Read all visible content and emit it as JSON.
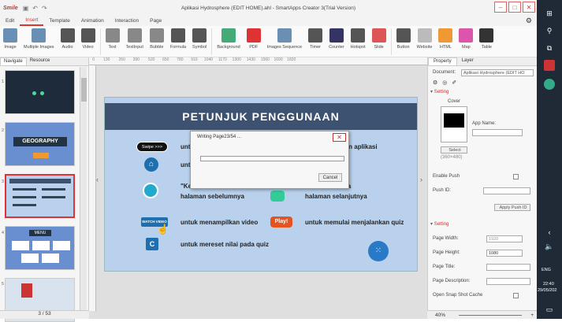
{
  "window": {
    "logo": "Smile",
    "title": "Aplikasi Hydrosphere (EDIT HOME).ahl - SmartApps Creator 3(Trial Version)"
  },
  "menu": [
    "Edit",
    "Insert",
    "Template",
    "Animation",
    "Interaction",
    "Page"
  ],
  "ribbon": [
    {
      "label": "Image",
      "color": "#6a8fb5"
    },
    {
      "label": "Multiple Images",
      "color": "#6a8fb5"
    },
    {
      "label": "Audio",
      "color": "#555"
    },
    {
      "label": "Video",
      "color": "#555"
    },
    {
      "label": "Text",
      "color": "#888"
    },
    {
      "label": "TextInput",
      "color": "#888"
    },
    {
      "label": "Bubble",
      "color": "#888"
    },
    {
      "label": "Formula",
      "color": "#555"
    },
    {
      "label": "Symbol",
      "color": "#555"
    },
    {
      "label": "Background",
      "color": "#4a7"
    },
    {
      "label": "PDF",
      "color": "#d33"
    },
    {
      "label": "Images Sequence",
      "color": "#6a8fb5"
    },
    {
      "label": "Timer",
      "color": "#555"
    },
    {
      "label": "Counter",
      "color": "#336"
    },
    {
      "label": "Hotspot",
      "color": "#555"
    },
    {
      "label": "Slide",
      "color": "#d55"
    },
    {
      "label": "Button",
      "color": "#555"
    },
    {
      "label": "Website",
      "color": "#bbb"
    },
    {
      "label": "HTML",
      "color": "#e93"
    },
    {
      "label": "Map",
      "color": "#d5a"
    },
    {
      "label": "Table",
      "color": "#333"
    }
  ],
  "left": {
    "tabs": [
      "Navigate",
      "Resource"
    ],
    "thumbs": [
      "1",
      "2",
      "3",
      "4",
      "5"
    ],
    "page_status": "3 / 53"
  },
  "slide": {
    "heading": "PETUNJUK PENGGUNAAN",
    "row1_left": "untu",
    "row1_right": "jalankan aplikasi",
    "row2_left": "untu",
    "row2_right": "RT",
    "row3_left_a": "\"Ke",
    "row3_left_b": "halaman sebelumnya",
    "row3_right_a": "embuka",
    "row3_right_b": "halaman selanjutnya",
    "row4_left": "untuk menampilkan video",
    "row4_right": "untuk memulai menjalankan quiz",
    "row5_left": "untuk mereset nilai pada quiz",
    "btn_swipe": "Swipe >>>",
    "btn_watch": "WATCH VIDEO",
    "btn_play": "Play!"
  },
  "dialog": {
    "title": "Writing Page23/54 ...",
    "cancel": "Cancel",
    "progress": 0.0
  },
  "right": {
    "tabs": [
      "Property",
      "Layer"
    ],
    "document_label": "Document:",
    "document_value": "Aplikasi Hydrosphere (EDIT HO",
    "setting1": "Setting",
    "cover": "Cover",
    "app_name": "App Name:",
    "select": "Select",
    "size": "(360×480)",
    "enable_push": "Enable Push",
    "push_id": "Push ID:",
    "apply_push": "Apply Push ID",
    "setting2": "Setting",
    "page_width": "Page Width:",
    "page_width_val": "1920",
    "page_height": "Page Height:",
    "page_height_val": "1080",
    "page_title": "Page Title:",
    "page_desc": "Page Description:",
    "snap": "Open Snap Shot Cache",
    "zoom": "40%"
  },
  "taskbar": {
    "lang": "ENG",
    "time": "22:40",
    "date": "29/05/202"
  }
}
